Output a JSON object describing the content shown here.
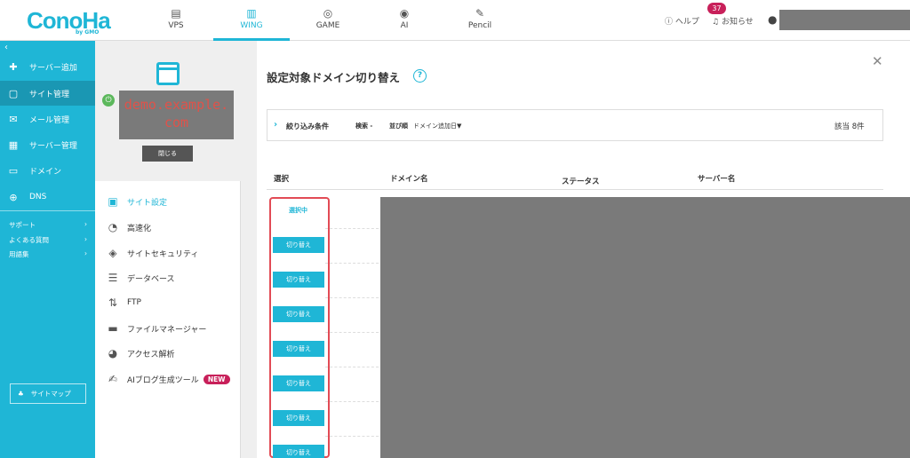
{
  "header": {
    "logo": "ConoHa",
    "logo_sub": "by GMO",
    "tabs": [
      {
        "label": "VPS",
        "icon": "server-icon"
      },
      {
        "label": "WING",
        "icon": "wing-icon"
      },
      {
        "label": "GAME",
        "icon": "gamepad-icon"
      },
      {
        "label": "AI",
        "icon": "ai-icon"
      },
      {
        "label": "Pencil",
        "icon": "pencil-icon"
      }
    ],
    "help": "ヘルプ",
    "notice": "お知らせ",
    "notice_count": "37"
  },
  "sidebar": {
    "items": [
      {
        "label": "サーバー追加",
        "icon": "plus-icon"
      },
      {
        "label": "サイト管理",
        "icon": "window-icon"
      },
      {
        "label": "メール管理",
        "icon": "mail-icon"
      },
      {
        "label": "サーバー管理",
        "icon": "server-manage-icon"
      },
      {
        "label": "ドメイン",
        "icon": "domain-icon"
      },
      {
        "label": "DNS",
        "icon": "globe-icon"
      }
    ],
    "links": [
      {
        "label": "サポート"
      },
      {
        "label": "よくある質問"
      },
      {
        "label": "用語集"
      }
    ],
    "sitemap": "サイトマップ"
  },
  "site": {
    "domain": "demo.example.\ncom",
    "close": "閉じる",
    "menu": [
      {
        "label": "サイト設定",
        "icon": "site-settings-icon"
      },
      {
        "label": "高速化",
        "icon": "stopwatch-icon"
      },
      {
        "label": "サイトセキュリティ",
        "icon": "shield-icon"
      },
      {
        "label": "データベース",
        "icon": "database-icon"
      },
      {
        "label": "FTP",
        "icon": "ftp-icon"
      },
      {
        "label": "ファイルマネージャー",
        "icon": "folder-icon"
      },
      {
        "label": "アクセス解析",
        "icon": "pie-chart-icon"
      },
      {
        "label": "AIブログ生成ツール",
        "icon": "ai-blog-icon",
        "badge": "NEW"
      }
    ]
  },
  "main": {
    "title": "設定対象ドメイン切り替え",
    "filter": {
      "label": "絞り込み条件",
      "search": "検索 -",
      "sort_label": "並び順",
      "sort_value": "ドメイン追加日▼",
      "count": "該当 8件"
    },
    "columns": [
      "選択",
      "ドメイン名",
      "ステータス",
      "サーバー名"
    ],
    "selected": "選択中",
    "switch_label": "切り替え"
  },
  "colors": {
    "accent": "#1fb6d6",
    "badge": "#c8205a",
    "highlight": "#e24b55"
  }
}
